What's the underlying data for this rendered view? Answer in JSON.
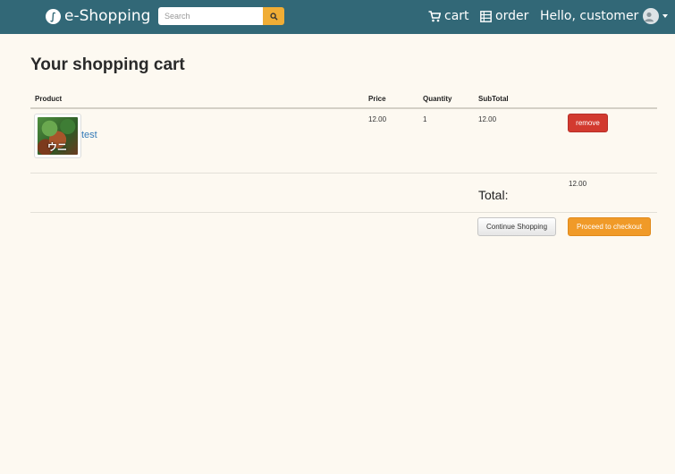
{
  "navbar": {
    "brand": "e-Shopping",
    "search_placeholder": "Search",
    "cart_label": "cart",
    "order_label": "order",
    "greeting": "Hello, customer"
  },
  "page": {
    "title": "Your shopping cart"
  },
  "cart_table": {
    "columns": [
      "Product",
      "Price",
      "Quantity",
      "SubTotal"
    ],
    "rows": [
      {
        "image_text": "ウニ",
        "product": "test",
        "price": "12.00",
        "quantity": "1",
        "subtotal": "12.00",
        "remove_label": "remove"
      }
    ],
    "total_value": "12.00",
    "total_label": "Total:"
  },
  "actions": {
    "continue_label": "Continue Shopping",
    "checkout_label": "Proceed to checkout"
  },
  "colors": {
    "navbar": "#326877",
    "accent": "#f0ad35",
    "danger": "#d23a2f",
    "link": "#337ab7",
    "background": "#fdf9f1"
  },
  "icons": [
    "feather-icon",
    "search-icon",
    "cart-icon",
    "list-icon",
    "avatar-icon",
    "caret-down-icon"
  ]
}
